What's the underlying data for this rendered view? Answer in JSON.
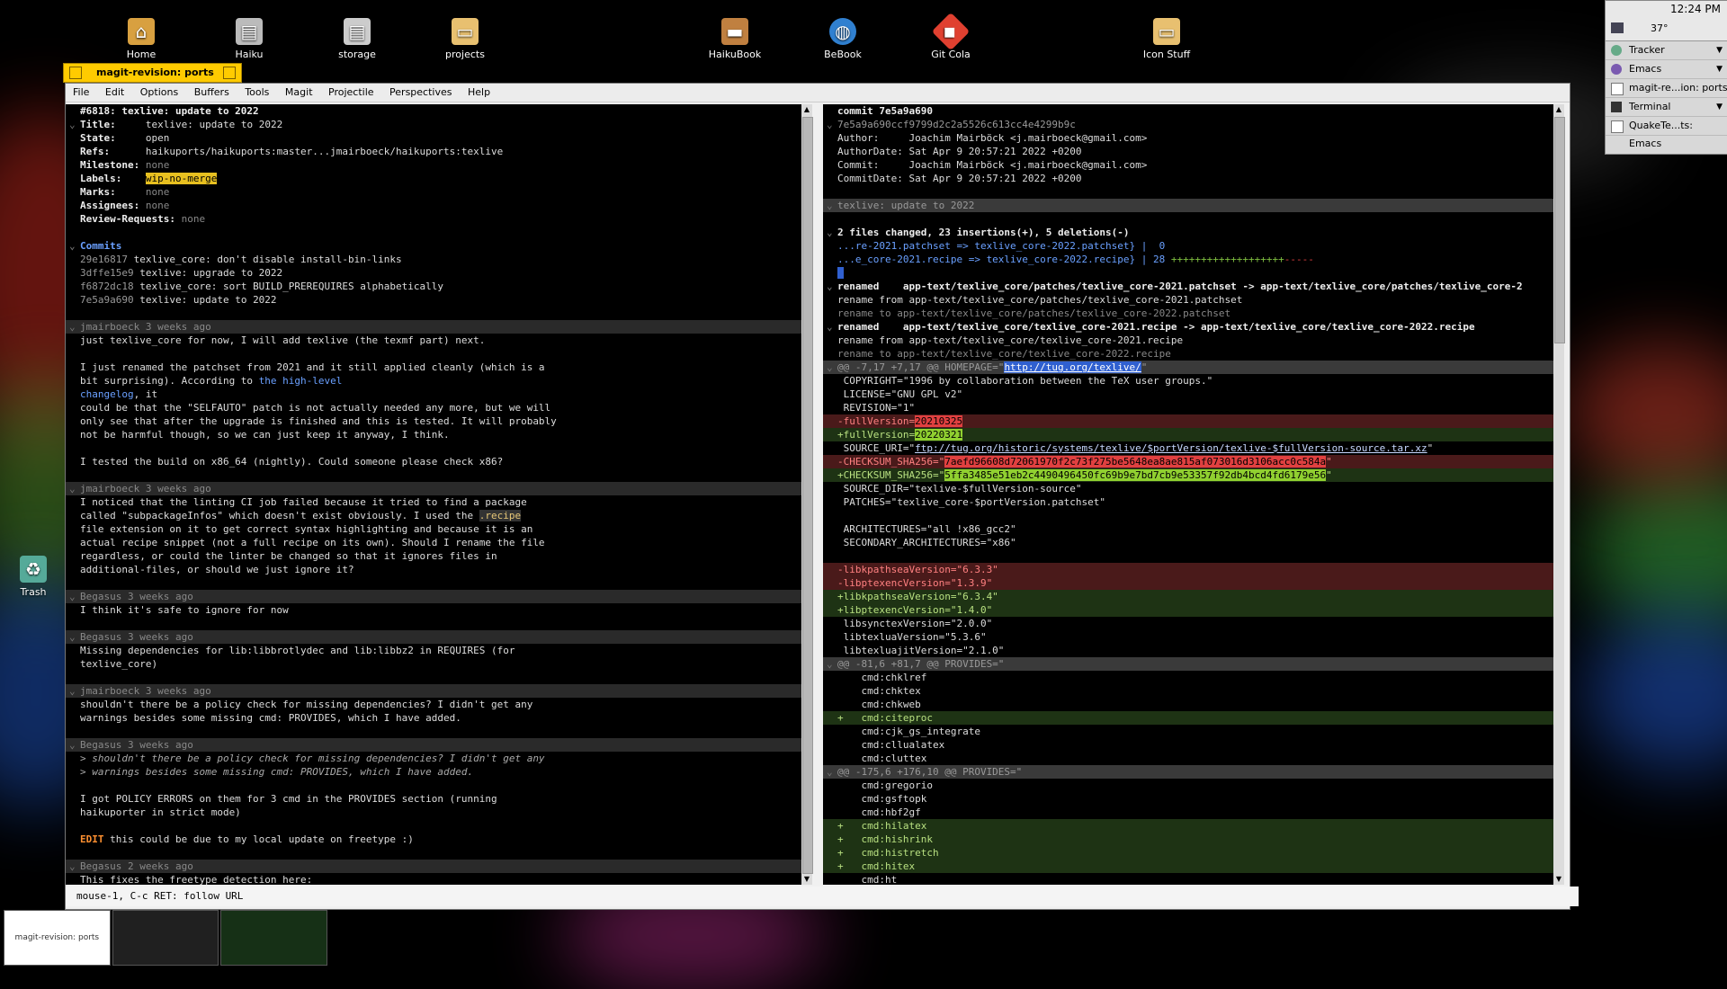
{
  "desktop": {
    "icons": [
      {
        "label": "Home",
        "icon": "home-icon"
      },
      {
        "label": "Haiku",
        "icon": "disk-icon"
      },
      {
        "label": "storage",
        "icon": "disk-icon"
      },
      {
        "label": "projects",
        "icon": "folder-icon"
      },
      {
        "label": "HaikuBook",
        "icon": "book-icon"
      },
      {
        "label": "BeBook",
        "icon": "globe-icon"
      },
      {
        "label": "Git Cola",
        "icon": "git-icon"
      },
      {
        "label": "Icon Stuff",
        "icon": "folder-icon"
      },
      {
        "label": "Trash",
        "icon": "trash-icon"
      }
    ]
  },
  "deskbar": {
    "time": "12:24 PM",
    "temp": "37°",
    "items": [
      {
        "label": "Tracker"
      },
      {
        "label": "Emacs"
      },
      {
        "label": "magit-re...ion: ports"
      },
      {
        "label": "Terminal"
      },
      {
        "label": "QuakeTe...ts: Emacs"
      }
    ]
  },
  "window": {
    "title": "magit-revision: ports",
    "menu": [
      "File",
      "Edit",
      "Options",
      "Buffers",
      "Tools",
      "Magit",
      "Projectile",
      "Perspectives",
      "Help"
    ],
    "echo": "mouse-1, C-c RET: follow URL"
  },
  "left": {
    "pr_title": "#6818: texlive: update to 2022",
    "title_label": "Title:",
    "title_val": "texlive: update to 2022",
    "state_label": "State:",
    "state_val": "open",
    "refs_label": "Refs:",
    "refs_val": "haikuports/haikuports:master...jmairboeck/haikuports:texlive",
    "milestone_label": "Milestone:",
    "milestone_val": "none",
    "labels_label": "Labels:",
    "labels_val": "wip-no-merge",
    "marks_label": "Marks:",
    "marks_val": "none",
    "assignees_label": "Assignees:",
    "assignees_val": "none",
    "review_label": "Review-Requests:",
    "review_val": "none",
    "commits_title": "Commits",
    "commits": [
      {
        "hash": "29e16817",
        "msg": "texlive_core: don't disable install-bin-links"
      },
      {
        "hash": "3dffe15e9",
        "msg": "texlive: upgrade to 2022"
      },
      {
        "hash": "f6872dc18",
        "msg": "texlive_core: sort BUILD_PREREQUIRES alphabetically"
      },
      {
        "hash": "7e5a9a690",
        "msg": "texlive: update to 2022"
      }
    ],
    "c1_hdr": "jmairboeck 3 weeks ago",
    "c1_l1": "just texlive_core for now, I will add texlive (the texmf part) next.",
    "c1_l2": "I just renamed the patchset from 2021 and it still applied cleanly (which is a",
    "c1_l3a": "bit surprising). According to ",
    "c1_l3link": "the high-level",
    "c1_l4link": "changelog",
    "c1_l4b": ", it",
    "c1_l5": "could be that the \"SELFAUTO\" patch is not actually needed any more, but we will",
    "c1_l6": "only see that after the upgrade is finished and this is tested. It will probably",
    "c1_l7": "not be harmful though, so we can just keep it anyway, I think.",
    "c1_l8": "I tested the build on x86_64 (nightly). Could someone please check x86?",
    "c2_hdr": "jmairboeck 3 weeks ago",
    "c2_l1": "I noticed that the linting CI job failed because it tried to find a package",
    "c2_l2a": "called \"subpackageInfos\" which doesn't exist obviously. I used the ",
    "c2_l2code": ".recipe",
    "c2_l3": "file extension on it to get correct syntax highlighting and because it is an",
    "c2_l4": "actual recipe snippet (not a full recipe on its own). Should I rename the file",
    "c2_l5": "regardless, or could the linter be changed so that it ignores files in",
    "c2_l6": "additional-files, or should we just ignore it?",
    "c3_hdr": "Begasus 3 weeks ago",
    "c3_l1": "I think it's safe to ignore for now",
    "c4_hdr": "Begasus 3 weeks ago",
    "c4_l1": "Missing dependencies for lib:libbrotlydec and lib:libbz2 in REQUIRES (for",
    "c4_l2": "texlive_core)",
    "c5_hdr": "jmairboeck 3 weeks ago",
    "c5_l1": "shouldn't there be a policy check for missing dependencies? I didn't get any",
    "c5_l2": "warnings besides some missing cmd: PROVIDES, which I have added.",
    "c6_hdr": "Begasus 3 weeks ago",
    "c6_q1": "> shouldn't there be a policy check for missing dependencies? I didn't get any",
    "c6_q2": "> warnings besides some missing cmd: PROVIDES, which I have added.",
    "c6_l1": "I got POLICY ERRORS on them for 3 cmd in the PROVIDES section (running",
    "c6_l2": "haikuporter in strict mode)",
    "c6_edit": "EDIT",
    "c6_l3": " this could be due to my local update on freetype :)",
    "c7_hdr": "Begasus 2 weeks ago",
    "c7_l1": "This fixes the freetype detection here:"
  },
  "right": {
    "commit": "commit 7e5a9a690",
    "full_hash": "7e5a9a690ccf9799d2c2a5526c613cc4e4299b9c",
    "author": "Author:     Joachim Mairböck <j.mairboeck@gmail.com>",
    "authordate": "AuthorDate: Sat Apr 9 20:57:21 2022 +0200",
    "committer": "Commit:     Joachim Mairböck <j.mairboeck@gmail.com>",
    "commitdate": "CommitDate: Sat Apr 9 20:57:21 2022 +0200",
    "subject": "texlive: update to 2022",
    "stat": "2 files changed, 23 insertions(+), 5 deletions(-)",
    "stat1": "...re-2021.patchset => texlive_core-2022.patchset} |  0",
    "stat2a": "...e_core-2021.recipe => texlive_core-2022.recipe} | 28 ",
    "stat2plus": "+++++++++++++++++++",
    "stat2minus": "-----",
    "ren1": "renamed    app-text/texlive_core/patches/texlive_core-2021.patchset -> app-text/texlive_core/patches/texlive_core-2",
    "ren1a": "rename from app-text/texlive_core/patches/texlive_core-2021.patchset",
    "ren1b": "rename to app-text/texlive_core/patches/texlive_core-2022.patchset",
    "ren2": "renamed    app-text/texlive_core/texlive_core-2021.recipe -> app-text/texlive_core/texlive_core-2022.recipe",
    "ren2a": "rename from app-text/texlive_core/texlive_core-2021.recipe",
    "ren2b": "rename to app-text/texlive_core/texlive_core-2022.recipe",
    "hunk1": "@@ -7,17 +7,17 @@ HOMEPAGE=\"",
    "hunk1url": "http://tug.org/texlive/",
    "hunk1end": "\"",
    "d1": " COPYRIGHT=\"1996 by collaboration between the TeX user groups.\"",
    "d2": " LICENSE=\"GNU GPL v2\"",
    "d3": " REVISION=\"1\"",
    "d4a": "-fullVersion=",
    "d4b": "20210325",
    "d5a": "+fullVersion=",
    "d5b": "20220321",
    "d6a": " SOURCE_URI=\"",
    "d6url": "ftp://tug.org/historic/systems/texlive/$portVersion/texlive-$fullVersion-source.tar.xz",
    "d6b": "\"",
    "d7a": "-CHECKSUM_SHA256=\"",
    "d7b": "7aefd96608d72061970f2c73f275be5648ea8ae815af073016d3106acc0c584a",
    "d7c": "\"",
    "d8a": "+CHECKSUM_SHA256=\"",
    "d8b": "5ffa3485e51eb2c4490496450fc69b9e7bd7cb9e53357f92db4bcd4fd6179e56",
    "d8c": "\"",
    "d9": " SOURCE_DIR=\"texlive-$fullVersion-source\"",
    "d10": " PATCHES=\"texlive_core-$portVersion.patchset\"",
    "d11": " ARCHITECTURES=\"all !x86_gcc2\"",
    "d12": " SECONDARY_ARCHITECTURES=\"x86\"",
    "d13": "-libkpathseaVersion=\"6.3.3\"",
    "d14": "-libptexencVersion=\"1.3.9\"",
    "d15": "+libkpathseaVersion=\"6.3.4\"",
    "d16": "+libptexencVersion=\"1.4.0\"",
    "d17": " libsynctexVersion=\"2.0.0\"",
    "d18": " libtexluaVersion=\"5.3.6\"",
    "d19": " libtexluajitVersion=\"2.1.0\"",
    "hunk2": "@@ -81,6 +81,7 @@ PROVIDES=\"",
    "p1": "    cmd:chklref",
    "p2": "    cmd:chktex",
    "p3": "    cmd:chkweb",
    "p4": "+   cmd:citeproc",
    "p5": "    cmd:cjk_gs_integrate",
    "p6": "    cmd:cllualatex",
    "p7": "    cmd:cluttex",
    "hunk3": "@@ -175,6 +176,10 @@ PROVIDES=\"",
    "q1": "    cmd:gregorio",
    "q2": "    cmd:gsftopk",
    "q3": "    cmd:hbf2gf",
    "q4": "+   cmd:hilatex",
    "q5": "+   cmd:hishrink",
    "q6": "+   cmd:histretch",
    "q7": "+   cmd:hitex",
    "q8": "    cmd:ht"
  },
  "workspaces": {
    "ws1": "magit-revision: ports"
  }
}
